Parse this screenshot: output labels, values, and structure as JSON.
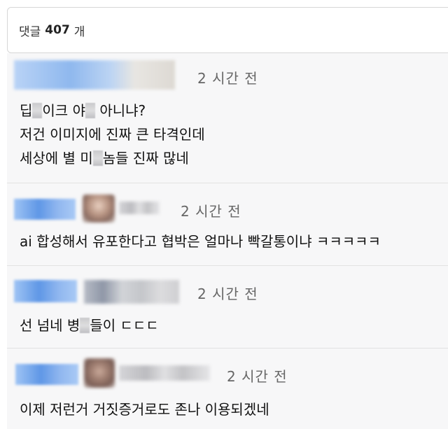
{
  "header": {
    "prefix": "댓글",
    "count": "407",
    "suffix": "개"
  },
  "comments": [
    {
      "time": "2 시간 전",
      "lines": [
        "딥",
        "이크 야",
        "아니냐?",
        "저건 이미지에 진짜 큰 타격인데",
        "세상에 별 미",
        "놈들 진짜 많네"
      ]
    },
    {
      "time": "2 시간 전",
      "lines": [
        "ai 합성해서 유포한다고 협박은 얼마나 빡갈통이냐 ㅋㅋㅋㅋㅋ"
      ]
    },
    {
      "time": "2 시간 전",
      "lines": [
        "선 넘네 병",
        "들이 ㄷㄷㄷ"
      ]
    },
    {
      "time": "2 시간 전",
      "lines": [
        "이제 저런거 거짓증거로도 존나 이용되겠네"
      ]
    }
  ]
}
